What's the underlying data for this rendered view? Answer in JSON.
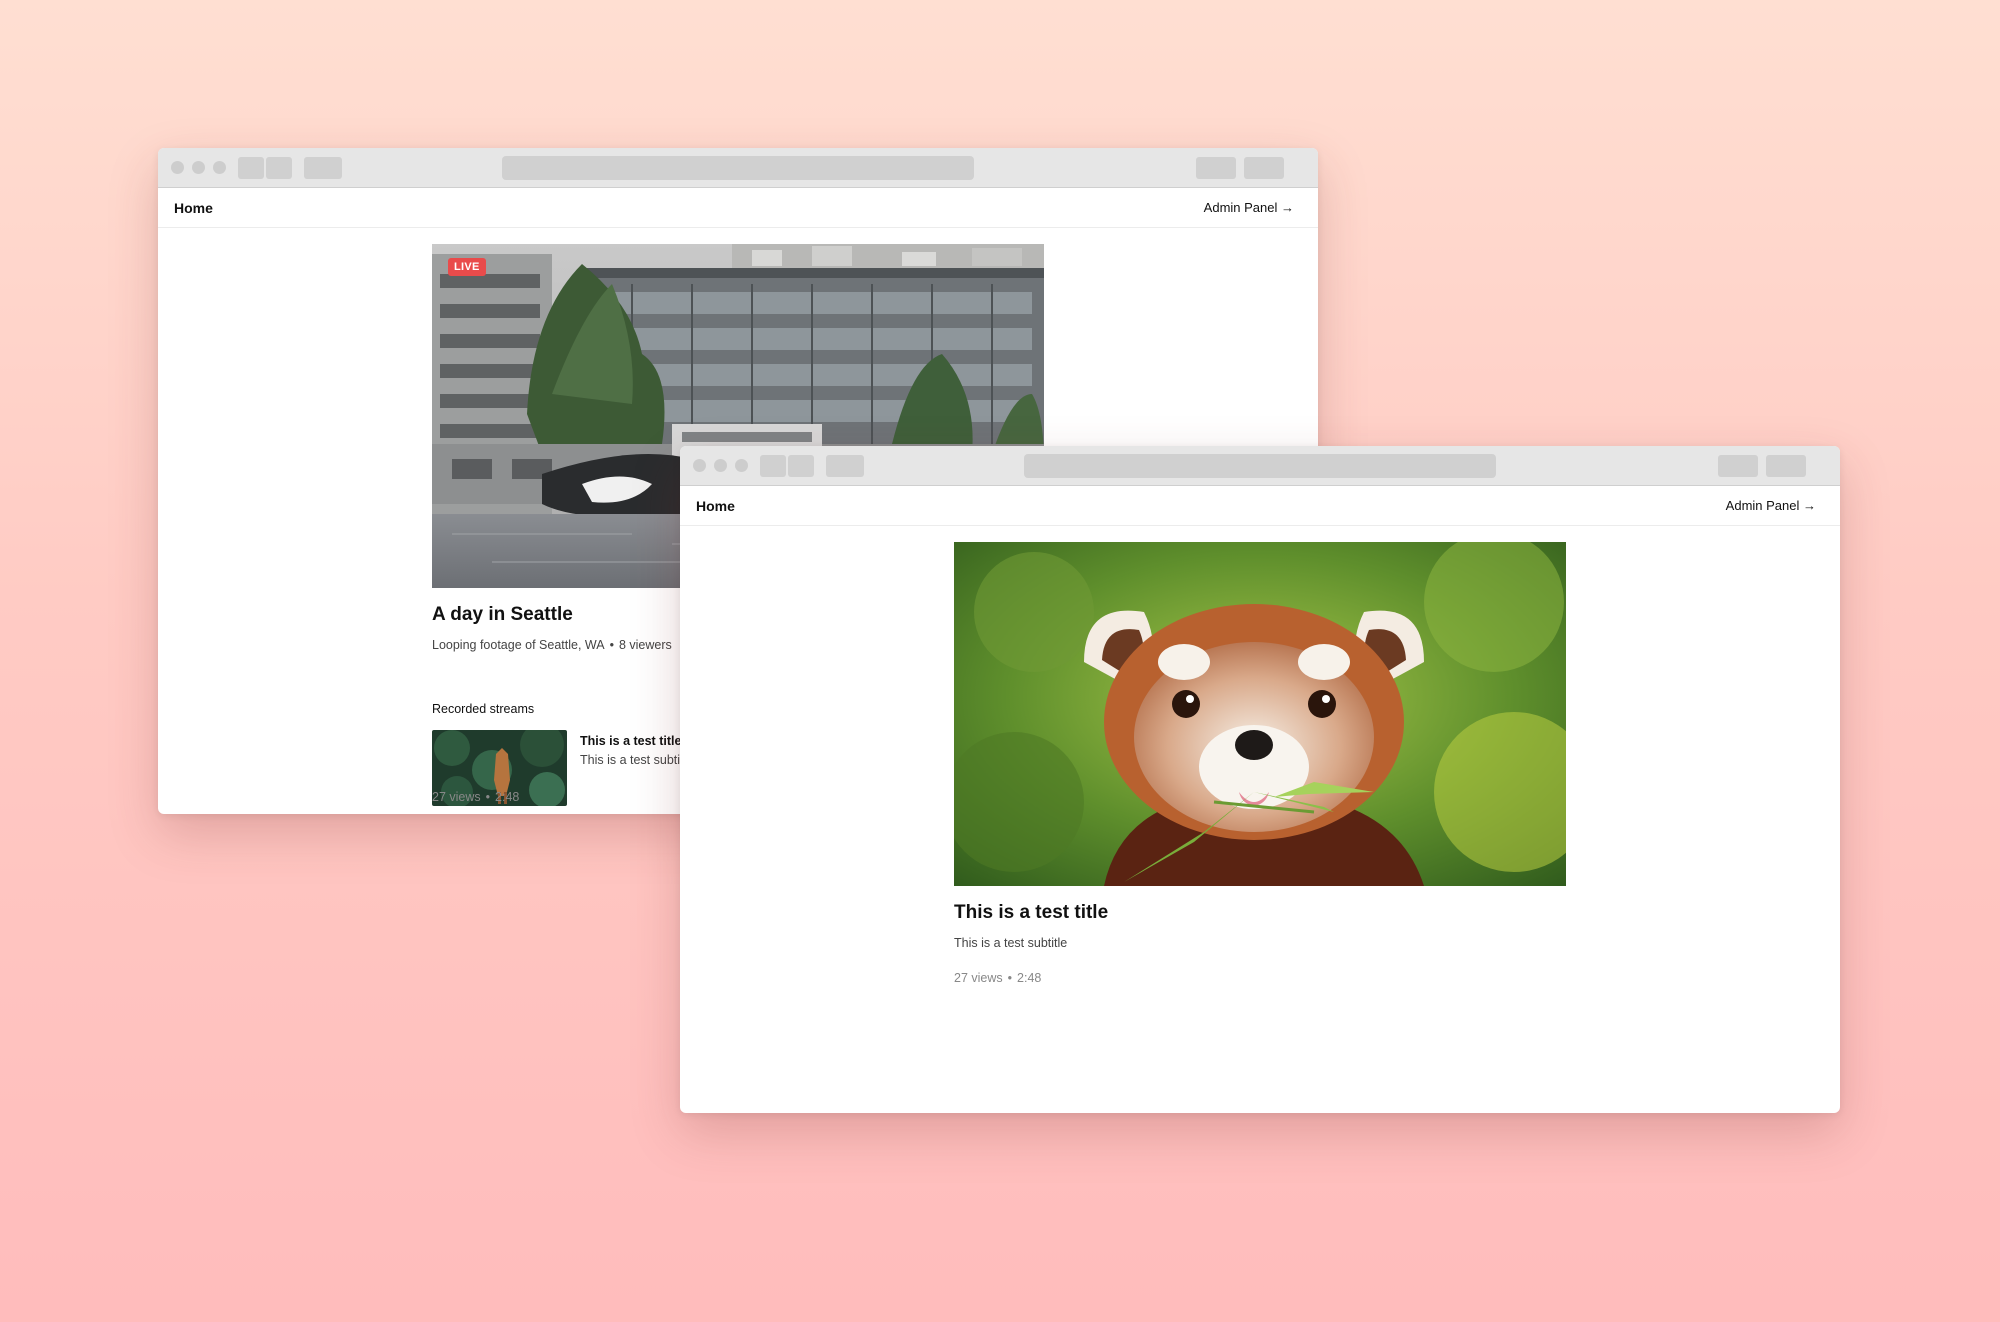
{
  "back_window": {
    "nav": {
      "home": "Home",
      "admin": "Admin Panel →"
    },
    "live_badge": "LIVE",
    "stream": {
      "title": "A day in Seattle",
      "description": "Looping footage of Seattle, WA",
      "viewers": "8 viewers"
    },
    "recorded_heading": "Recorded streams",
    "recorded": [
      {
        "title": "This is a test title",
        "subtitle": "This is a test subtitle",
        "views": "27 views",
        "duration": "2:48"
      }
    ]
  },
  "front_window": {
    "nav": {
      "home": "Home",
      "admin": "Admin Panel →"
    },
    "video": {
      "title": "This is a test title",
      "subtitle": "This is a test subtitle",
      "views": "27 views",
      "duration": "2:48"
    }
  },
  "separator": "•",
  "colors": {
    "live_badge": "#e94b4b",
    "background_top": "#ffdfd2",
    "background_bottom": "#ffbcbc"
  },
  "icons": {
    "arrow": "arrow-right-icon"
  }
}
